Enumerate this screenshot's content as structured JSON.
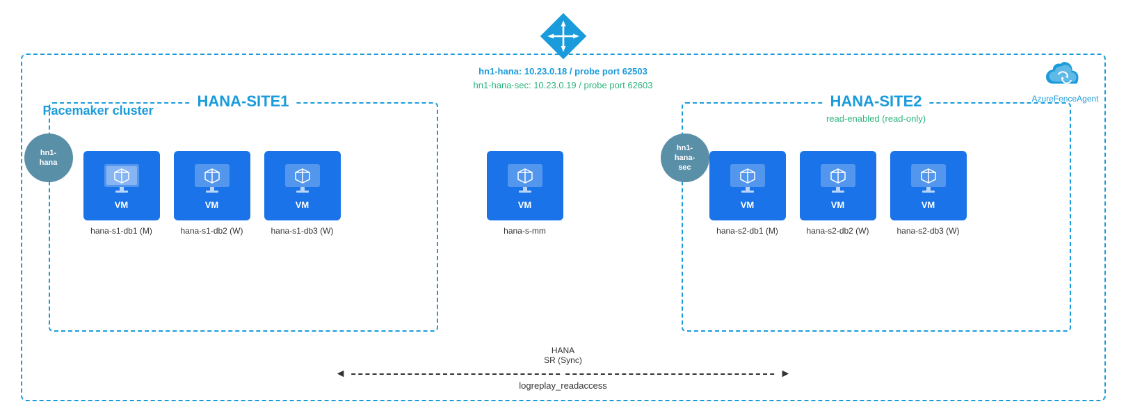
{
  "diagram": {
    "cluster_label": "Pacemaker cluster",
    "lb": {
      "primary_text": "hn1-hana:  10.23.0.18 / probe port 62503",
      "secondary_text": "hn1-hana-sec:  10.23.0.19 / probe port 62603"
    },
    "fence_agent_label": "AzureFenceAgent",
    "site1": {
      "title": "HANA-SITE1",
      "vip_label": "hn1-\nhana",
      "vms": [
        {
          "name": "hana-s1-db1 (M)"
        },
        {
          "name": "hana-s1-db2 (W)"
        },
        {
          "name": "hana-s1-db3 (W)"
        }
      ]
    },
    "site2": {
      "title": "HANA-SITE2",
      "vip_label": "hn1-\nhana-\nsec",
      "read_enabled": "read-enabled (read-only)",
      "vms": [
        {
          "name": "hana-s2-db1 (M)"
        },
        {
          "name": "hana-s2-db2 (W)"
        },
        {
          "name": "hana-s2-db3 (W)"
        }
      ]
    },
    "middle_vm": {
      "name": "hana-s-mm"
    },
    "hana_sr": {
      "line1": "HANA",
      "line2": "SR (Sync)",
      "line3": "logreplay_readaccess"
    },
    "vm_label": "VM",
    "colors": {
      "blue": "#1a73e8",
      "light_blue": "#1a9bdb",
      "green": "#2db37e",
      "gray_blue": "#5a8fa8"
    }
  }
}
